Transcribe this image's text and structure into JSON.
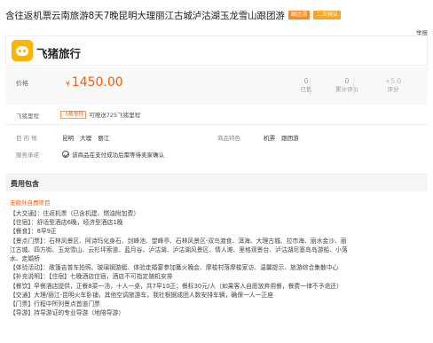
{
  "header": {
    "title": "含往返机票云南旅游8天7晚昆明大理丽江古城泸沽湖玉龙雪山跟团游",
    "tags": [
      "跟团游",
      "二次确认"
    ],
    "report": "举报"
  },
  "brand": {
    "name": "飞猪旅行"
  },
  "price": {
    "label": "价格",
    "currency": "¥",
    "value": "1450.00",
    "stats": [
      {
        "num": "0",
        "label": "已售"
      },
      {
        "num": "0",
        "label": "累计评价"
      },
      {
        "num": "+5.0",
        "label": "评分"
      }
    ]
  },
  "points": {
    "label": "飞猪里程",
    "tag": "飞猪里程",
    "text": "可赠送725飞猪里程"
  },
  "info": {
    "destination_label": "目 的 地",
    "destinations": [
      "昆明",
      "大理",
      "丽江"
    ],
    "feature_label": "商品特色",
    "features": [
      "机票",
      "跟团游"
    ],
    "promise_label": "服务承诺",
    "promise_text": "该商品在支付成功后需等待卖家确认"
  },
  "section": {
    "title": "费用包含",
    "notice": "无额外自费项目"
  },
  "package_lines": [
    "【大交通】：往返机票（已含机建、燃油附加费）",
    "【住宿】：舒适型酒店6晚，经济型酒店1晚",
    "【餐食】：8早9正",
    "【景点门票】：石林风景区、阿诗玛化身石、剑峰池、望峰亭、石林风景区-双鸟渡食、洱海、大理古城、拉市海、丽水金沙、丽",
    "江古城、四方街、玉龙雪山、云杉坪索道、蓝月谷、泸沽湖、泸沽湖风景区、情人滩、里格观景台、泸沽湖尼塞岛岛游船、小落",
    "水、走婚桥",
    "【体验活动】：敞篷吉普车拍照、玻璃钢游艇、体验走婚宴参加篝火晚会、摩梭村落摩梭家访、温馨提示、旅游综合集散中心",
    "【补充说明】：【住宿】七晚酒店住宿，酒店不可指定随机安排",
    "【餐饮】早餐酒店提供，正餐8菜一汤，十人一桌，共7早10正；餐标30元/人（如果客人自愿放弃用餐，餐费一律不予退还）",
    "【交通】大理/丽江-昆明火车卧铺，其他空调旅游车，我社根据成团人数安排车辆，确保一人一正座",
    "【门票】行程中所列景点首道门票",
    "【导游】持导游证的专业导游（地陪导游）"
  ]
}
